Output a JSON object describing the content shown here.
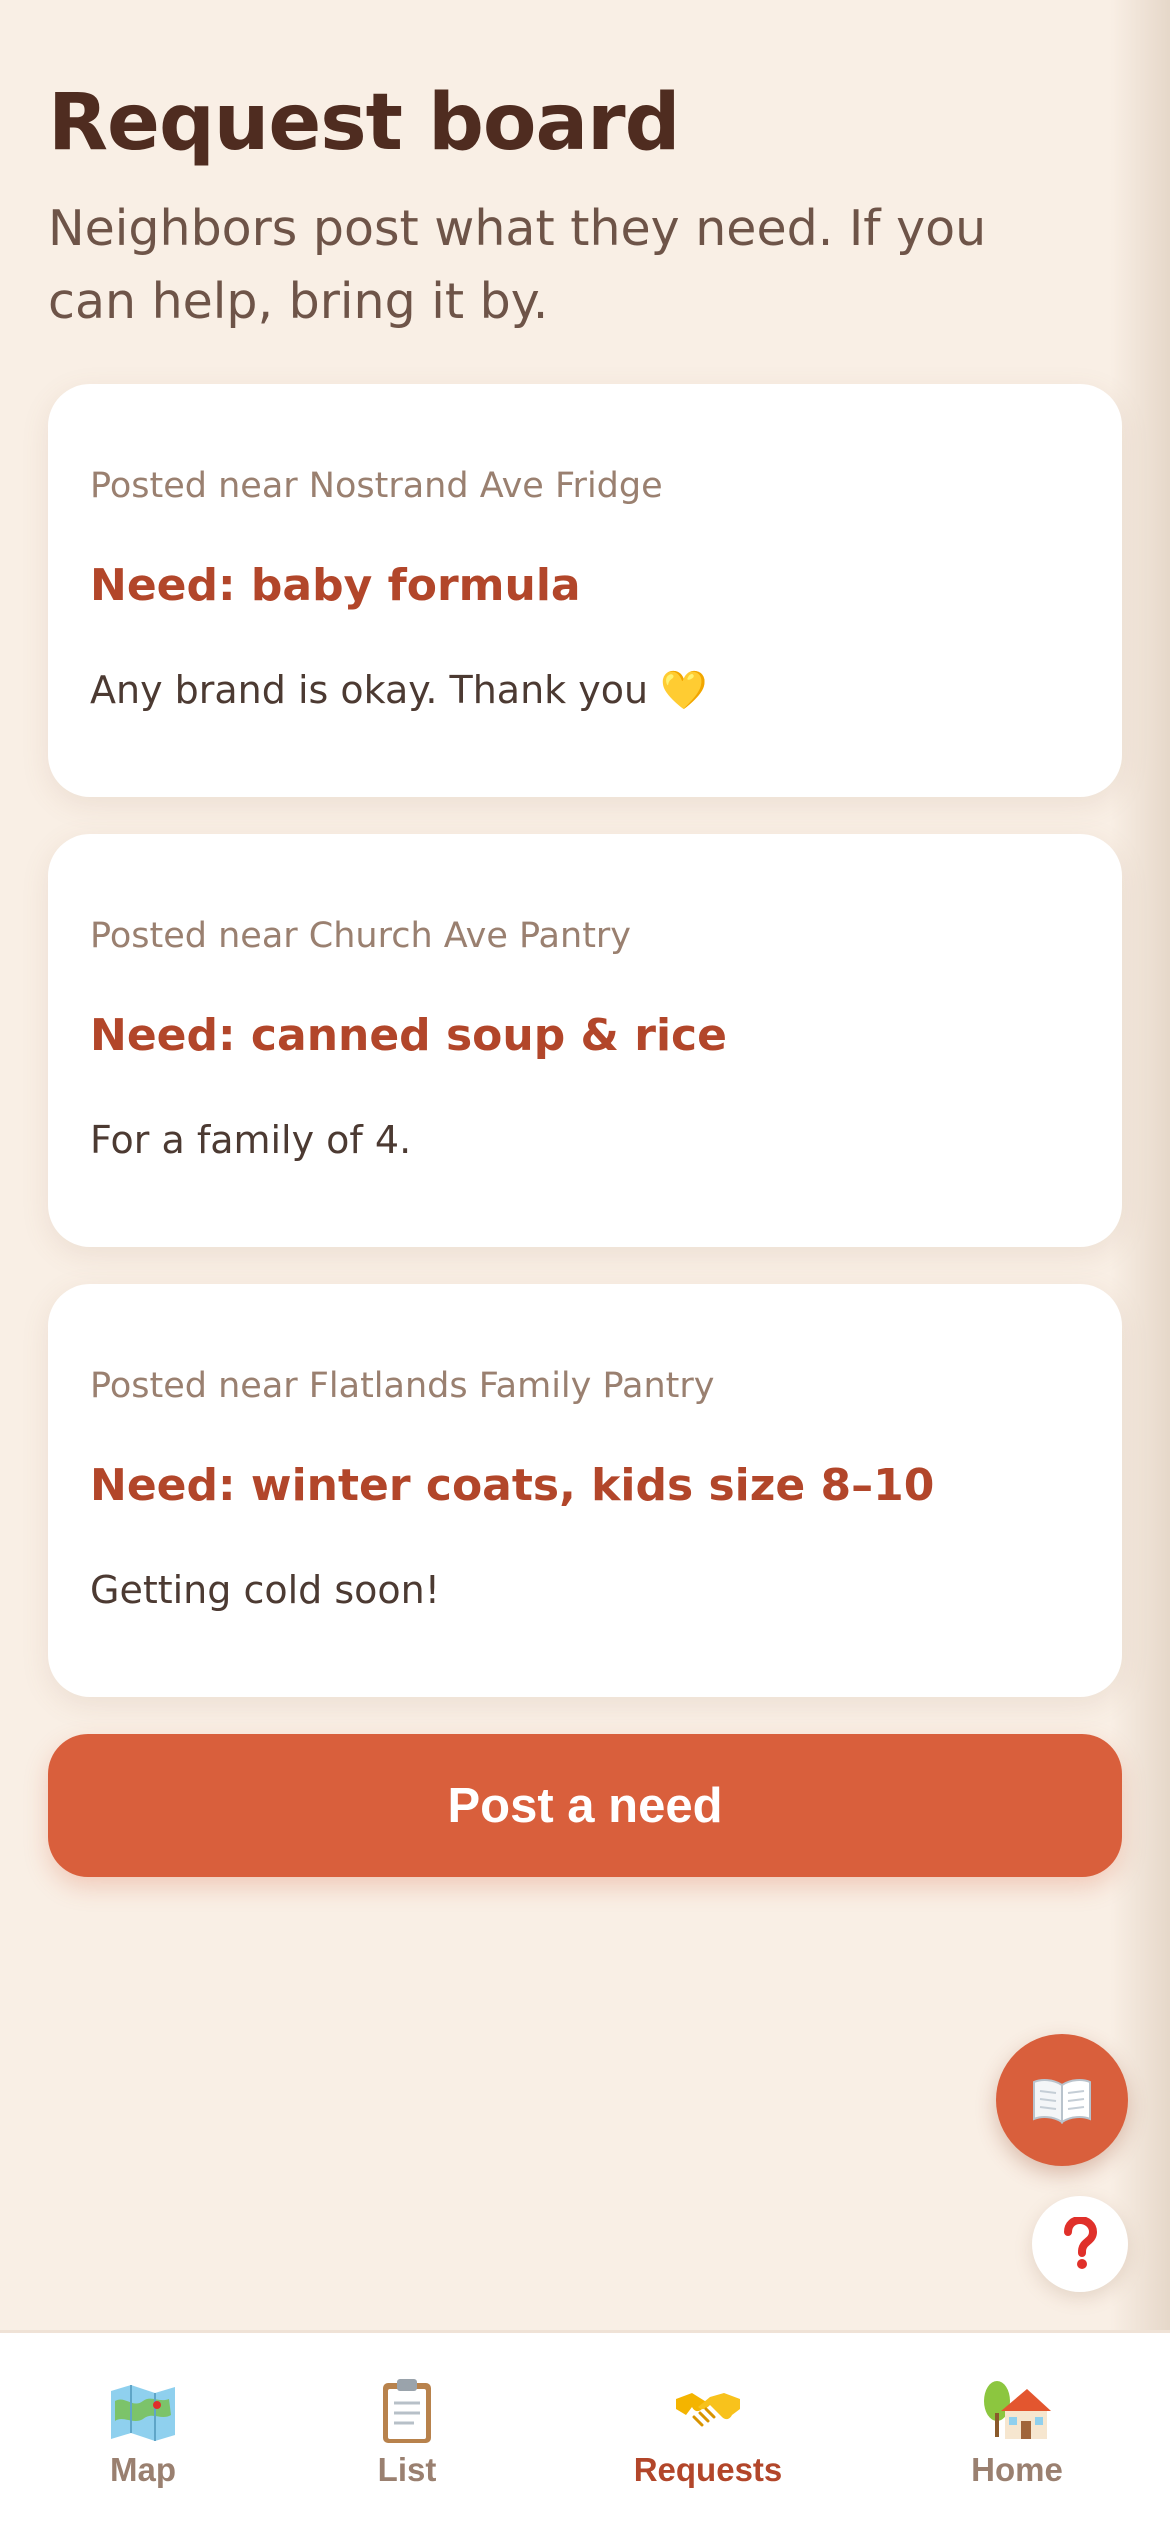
{
  "header": {
    "title": "Request board",
    "subtitle": "Neighbors post what they need. If you can help, bring it by."
  },
  "requests": [
    {
      "location": "Posted near Nostrand Ave Fridge",
      "need": "Need: baby formula",
      "note": "Any brand is okay. Thank you 💛"
    },
    {
      "location": "Posted near Church Ave Pantry",
      "need": "Need: canned soup & rice",
      "note": "For a family of 4."
    },
    {
      "location": "Posted near Flatlands Family Pantry",
      "need": "Need: winter coats, kids size 8–10",
      "note": "Getting cold soon!"
    }
  ],
  "actions": {
    "post_label": "Post a need",
    "guide_icon": "open-book-icon",
    "help_icon": "question-mark-icon"
  },
  "tabs": [
    {
      "label": "Map",
      "icon": "map-icon",
      "active": false
    },
    {
      "label": "List",
      "icon": "clipboard-icon",
      "active": false
    },
    {
      "label": "Requests",
      "icon": "handshake-icon",
      "active": true
    },
    {
      "label": "Home",
      "icon": "house-icon",
      "active": false
    }
  ],
  "colors": {
    "background": "#f9efe5",
    "accent": "#d95f3c",
    "heading": "#4f2c20",
    "need_text": "#b2462a",
    "muted": "#9a8070"
  }
}
